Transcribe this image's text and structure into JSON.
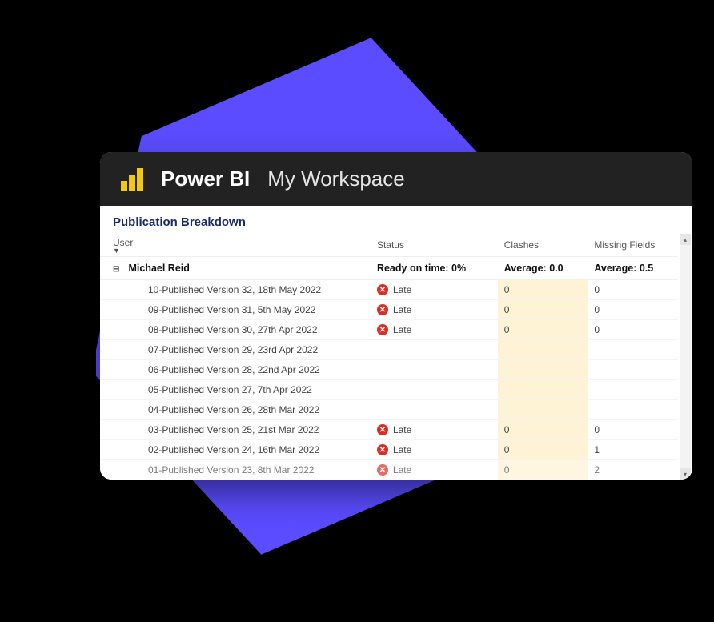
{
  "header": {
    "app_name": "Power BI",
    "workspace": "My Workspace"
  },
  "report": {
    "title": "Publication Breakdown",
    "columns": {
      "user": "User",
      "status": "Status",
      "clashes": "Clashes",
      "missing": "Missing Fields"
    },
    "group": {
      "name": "Michael Reid",
      "status_summary": "Ready on time: 0%",
      "clashes_summary": "Average: 0.0",
      "missing_summary": "Average: 0.5"
    },
    "rows": [
      {
        "name": "10-Published Version 32, 18th May 2022",
        "status": "Late",
        "clashes": "0",
        "missing": "0"
      },
      {
        "name": "09-Published Version 31, 5th May 2022",
        "status": "Late",
        "clashes": "0",
        "missing": "0"
      },
      {
        "name": "08-Published Version 30, 27th Apr 2022",
        "status": "Late",
        "clashes": "0",
        "missing": "0"
      },
      {
        "name": "07-Published Version 29, 23rd Apr 2022",
        "status": "",
        "clashes": "",
        "missing": ""
      },
      {
        "name": "06-Published Version 28, 22nd Apr 2022",
        "status": "",
        "clashes": "",
        "missing": ""
      },
      {
        "name": "05-Published Version 27, 7th Apr 2022",
        "status": "",
        "clashes": "",
        "missing": ""
      },
      {
        "name": "04-Published Version 26, 28th Mar 2022",
        "status": "",
        "clashes": "",
        "missing": ""
      },
      {
        "name": "03-Published Version 25, 21st Mar 2022",
        "status": "Late",
        "clashes": "0",
        "missing": "0"
      },
      {
        "name": "02-Published Version 24, 16th Mar 2022",
        "status": "Late",
        "clashes": "0",
        "missing": "1"
      },
      {
        "name": "01-Published Version 23, 8th Mar 2022",
        "status": "Late",
        "clashes": "0",
        "missing": "2"
      }
    ]
  }
}
